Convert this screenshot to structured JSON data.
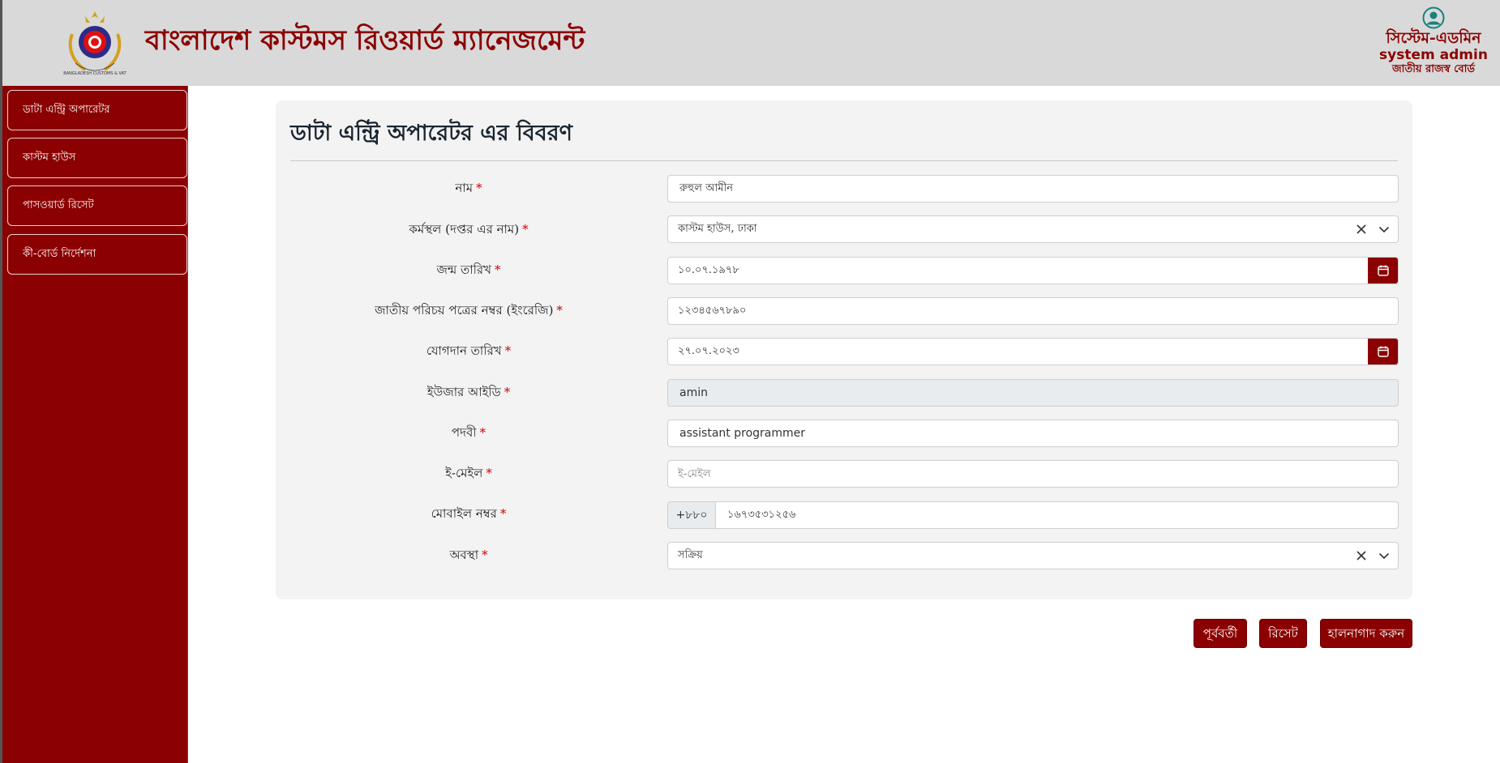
{
  "header": {
    "app_title": "বাংলাদেশ কাস্টমস রিওয়ার্ড ম্যানেজমেন্ট",
    "logo_text": "BANGLADESH CUSTOMS & VAT",
    "user": {
      "role": "সিস্টেম-এডমিন",
      "name": "system admin",
      "organization": "জাতীয় রাজস্ব বোর্ড"
    }
  },
  "sidebar": {
    "items": [
      {
        "label": "ডাটা এন্ট্রি অপারেটর"
      },
      {
        "label": "কাস্টম হাউস"
      },
      {
        "label": "পাসওয়ার্ড রিসেট"
      },
      {
        "label": "কী-বোর্ড নির্দেশনা"
      }
    ]
  },
  "form": {
    "title": "ডাটা এন্ট্রি অপারেটর এর বিবরণ",
    "required_mark": "*",
    "fields": {
      "name": {
        "label": "নাম",
        "value": "রুহুল আমীন"
      },
      "workplace": {
        "label": "কর্মস্থল (দপ্তর এর নাম)",
        "value": "কাস্টম হাউস, ঢাকা"
      },
      "dob": {
        "label": "জন্ম তারিখ",
        "value": "১০.০৭.১৯৭৮"
      },
      "nid": {
        "label": "জাতীয় পরিচয় পত্রের নম্বর (ইংরেজি)",
        "value": "১২৩৪৫৬৭৮৯০"
      },
      "joining_date": {
        "label": "যোগদান তারিখ",
        "value": "২৭.০৭.২০২৩"
      },
      "user_id": {
        "label": "ইউজার আইডি",
        "value": "amin"
      },
      "designation": {
        "label": "পদবী",
        "value": "assistant programmer"
      },
      "email": {
        "label": "ই-মেইল",
        "placeholder": "ই-মেইল"
      },
      "mobile": {
        "label": "মোবাইল নম্বর",
        "prefix": "+৮৮০",
        "value": "১৬৭৩৫৩১২৫৬"
      },
      "status": {
        "label": "অবস্থা",
        "value": "সক্রিয়"
      }
    }
  },
  "buttons": {
    "previous": "পূর্ববর্তী",
    "reset": "রিসেট",
    "update": "হালনাগাদ করুন"
  },
  "colors": {
    "brand": "#8b0000",
    "header_bg": "#d9d9d9",
    "card_bg": "#f3f3f3",
    "required": "#d00000"
  },
  "icons": {
    "logo": "customs-emblem-icon",
    "user": "user-avatar-icon",
    "clear": "close-icon",
    "dropdown": "chevron-down-icon",
    "date": "calendar-icon"
  }
}
